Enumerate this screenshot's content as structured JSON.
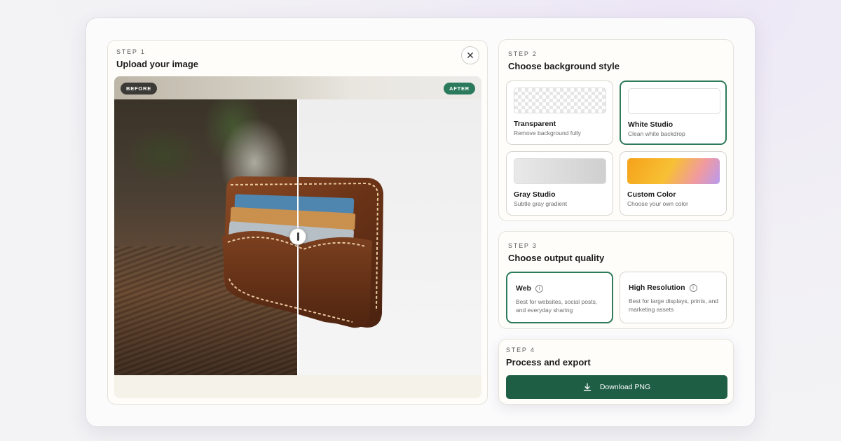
{
  "step1": {
    "label": "STEP 1",
    "title": "Upload your image",
    "before_tag": "BEFORE",
    "after_tag": "AFTER",
    "close_icon": "close-icon",
    "slider_position": 0.5
  },
  "step2": {
    "label": "STEP 2",
    "title": "Choose background style",
    "options": [
      {
        "title": "Transparent",
        "subtitle": "Remove background fully",
        "selected": false
      },
      {
        "title": "White Studio",
        "subtitle": "Clean white backdrop",
        "selected": true
      },
      {
        "title": "Gray Studio",
        "subtitle": "Subtle gray gradient",
        "selected": false
      },
      {
        "title": "Custom Color",
        "subtitle": "Choose your own color",
        "selected": false
      }
    ]
  },
  "step3": {
    "label": "STEP 3",
    "title": "Choose output quality",
    "options": [
      {
        "title": "Web",
        "description": "Best for websites, social posts, and everyday sharing",
        "selected": true
      },
      {
        "title": "High Resolution",
        "description": "Best for large displays, prints, and marketing assets",
        "selected": false
      }
    ]
  },
  "step4": {
    "label": "STEP 4",
    "title": "Process and export",
    "button_label": "Download PNG",
    "button_icon": "download-icon"
  },
  "colors": {
    "accent": "#1e5e45",
    "selected_border": "#2f7a5a"
  }
}
